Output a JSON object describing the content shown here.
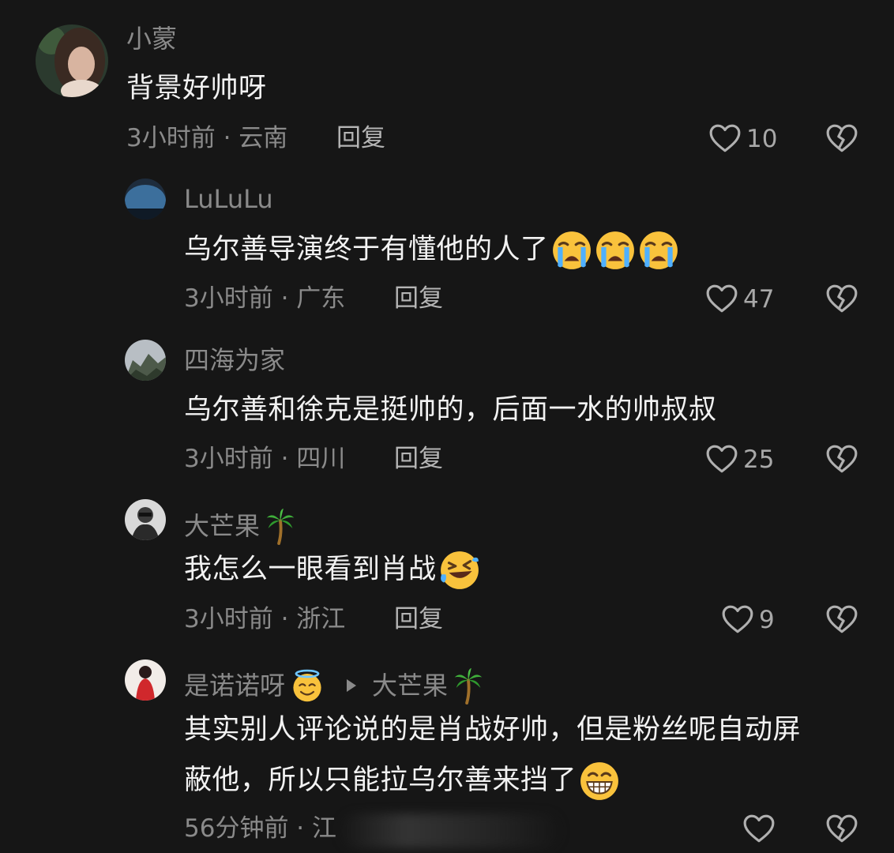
{
  "comments": [
    {
      "username": "小蒙",
      "text": "背景好帅呀",
      "meta": "3小时前 · 云南",
      "reply": "回复",
      "likes": "10"
    },
    {
      "username": "LuLuLu",
      "text": "乌尔善导演终于有懂他的人了",
      "meta": "3小时前 · 广东",
      "reply": "回复",
      "likes": "47"
    },
    {
      "username": "四海为家",
      "text": "乌尔善和徐克是挺帅的，后面一水的帅叔叔",
      "meta": "3小时前 · 四川",
      "reply": "回复",
      "likes": "25"
    },
    {
      "username": "大芒果",
      "text": "我怎么一眼看到肖战",
      "meta": "3小时前 · 浙江",
      "reply": "回复",
      "likes": "9"
    },
    {
      "username": "是诺诺呀",
      "reply_to": "大芒果",
      "text_line1": "其实别人评论说的是肖战好帅，但是粉丝呢自动屏",
      "text_line2": "蔽他，所以只能拉乌尔善来挡了",
      "meta": "56分钟前 · 江",
      "likes": ""
    }
  ],
  "icons": {
    "like": "heart-outline-icon",
    "dislike": "broken-heart-icon",
    "emoji_crying": "loudly-crying-face",
    "emoji_laughing": "rolling-on-floor-laughing",
    "emoji_grin": "grinning-face",
    "emoji_halo": "smiling-face-with-halo",
    "emoji_palm": "palm-tree"
  },
  "colors": {
    "background": "#161616",
    "text": "#f2f2f2",
    "secondary": "#8a8a8a"
  }
}
